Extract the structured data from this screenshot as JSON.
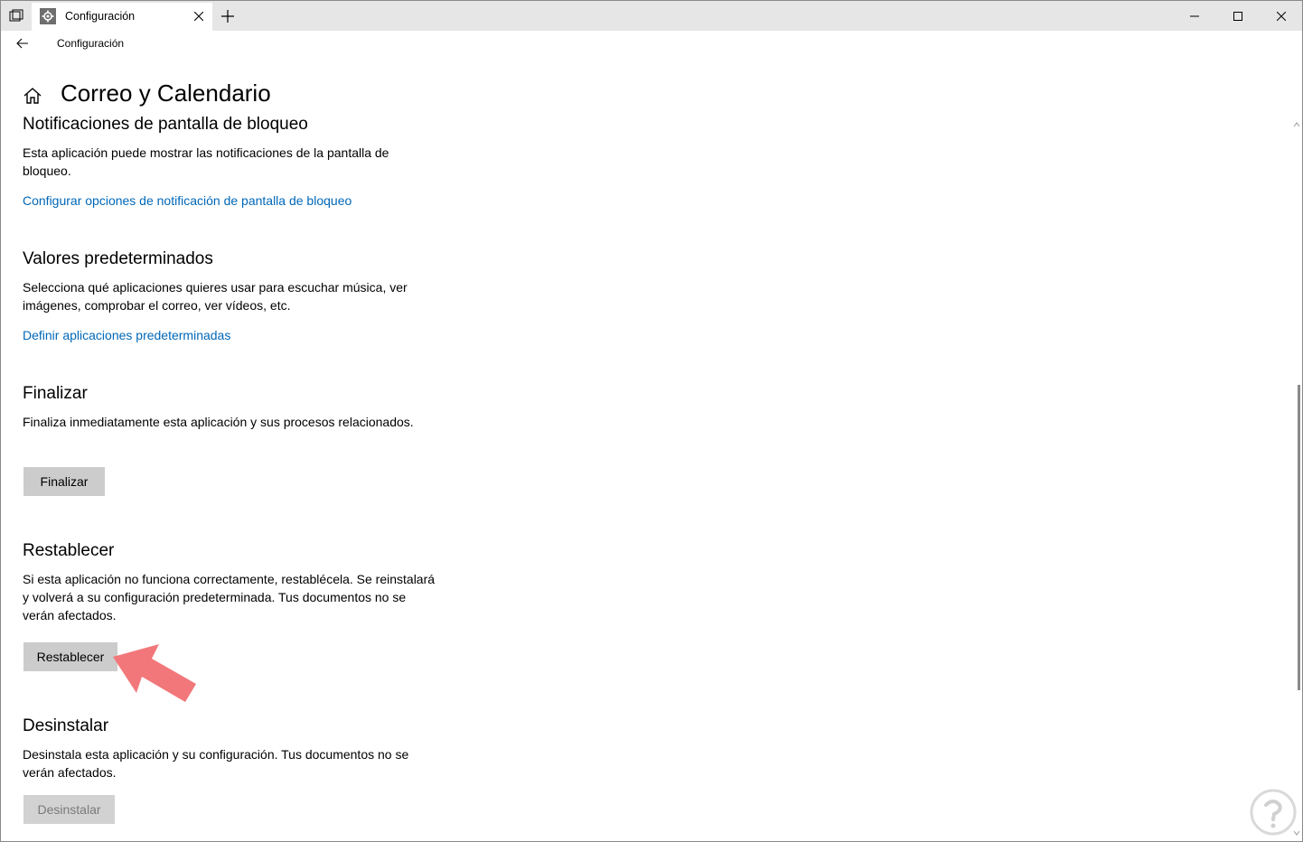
{
  "window": {
    "tab_title": "Configuración",
    "tab_icon": "gear-icon"
  },
  "nav": {
    "title": "Configuración"
  },
  "page": {
    "title": "Correo y Calendario"
  },
  "sections": {
    "lock": {
      "heading": "Notificaciones de pantalla de bloqueo",
      "description": "Esta aplicación puede mostrar las notificaciones de la pantalla de bloqueo.",
      "link": "Configurar opciones de notificación de pantalla de bloqueo"
    },
    "defaults": {
      "heading": "Valores predeterminados",
      "description": "Selecciona qué aplicaciones quieres usar para escuchar música, ver imágenes, comprobar el correo, ver vídeos, etc.",
      "link": "Definir aplicaciones predeterminadas"
    },
    "terminate": {
      "heading": "Finalizar",
      "description": "Finaliza inmediatamente esta aplicación y sus procesos relacionados.",
      "button": "Finalizar"
    },
    "reset": {
      "heading": "Restablecer",
      "description": "Si esta aplicación no funciona correctamente, restablécela. Se reinstalará y volverá a su configuración predeterminada. Tus documentos no se verán afectados.",
      "button": "Restablecer"
    },
    "uninstall": {
      "heading": "Desinstalar",
      "description": "Desinstala esta aplicación y su configuración. Tus documentos no se verán afectados.",
      "button": "Desinstalar"
    }
  },
  "colors": {
    "link": "#0067b8",
    "button": "#cccccc",
    "annotation_arrow": "#f2777a"
  }
}
